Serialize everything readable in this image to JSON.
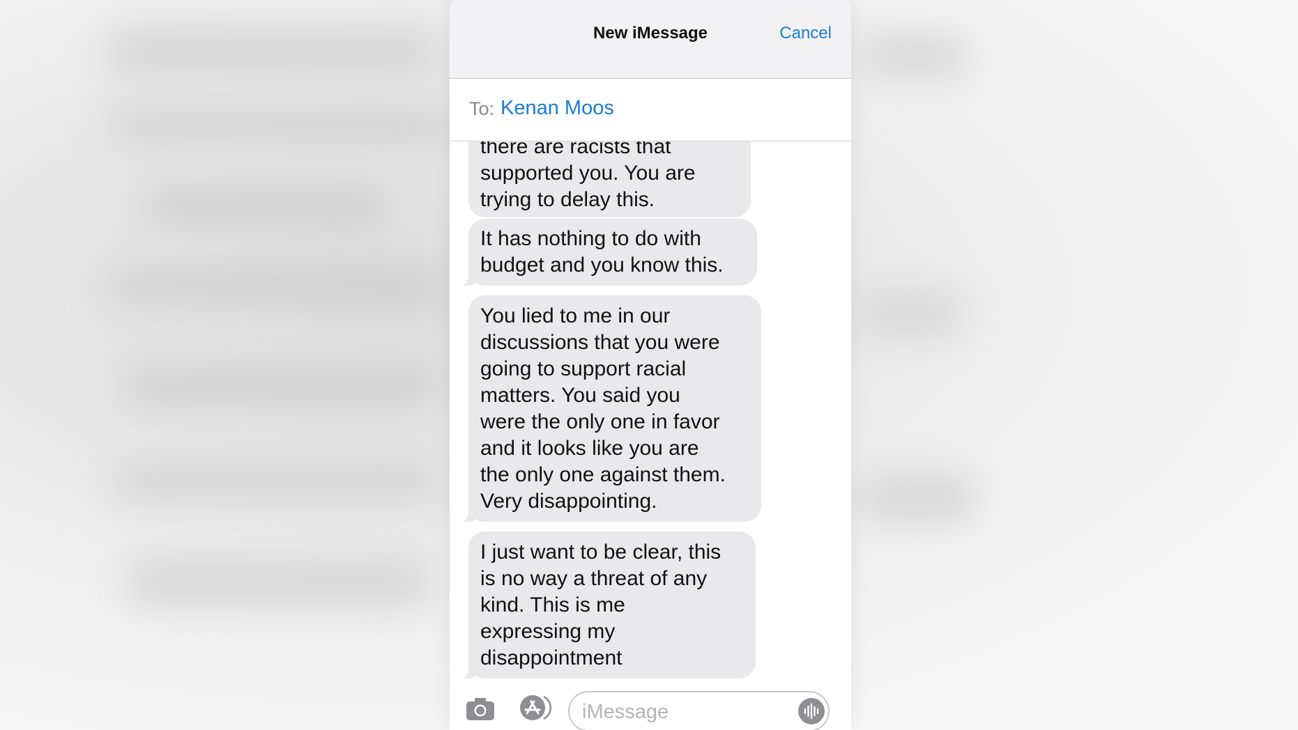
{
  "header": {
    "title": "New iMessage",
    "cancel_label": "Cancel"
  },
  "recipient": {
    "label": "To:",
    "name": "Kenan Moos"
  },
  "messages": [
    {
      "lines": [
        "there are racists that",
        "supported you.  You are",
        "trying to delay this."
      ]
    },
    {
      "lines": [
        "It has nothing to do with",
        "budget and you know this."
      ]
    },
    {
      "lines": [
        "You lied to me in our",
        "discussions that you were",
        "going to support racial",
        "matters.  You said you",
        "were the only one in favor",
        "and it looks like you are",
        "the only one against them.",
        "Very disappointing."
      ]
    },
    {
      "lines": [
        "I just want to be clear, this",
        "is no way a threat of any",
        "kind.  This is me",
        "expressing my",
        "disappointment"
      ]
    }
  ],
  "composer": {
    "placeholder": "iMessage"
  },
  "icons": {
    "camera": "camera-icon",
    "apps": "app-store-icon",
    "audio": "waveform-icon"
  },
  "colors": {
    "accent": "#1b7cd6",
    "bubble": "#e9e9eb",
    "navbar": "#f2f2f4"
  }
}
